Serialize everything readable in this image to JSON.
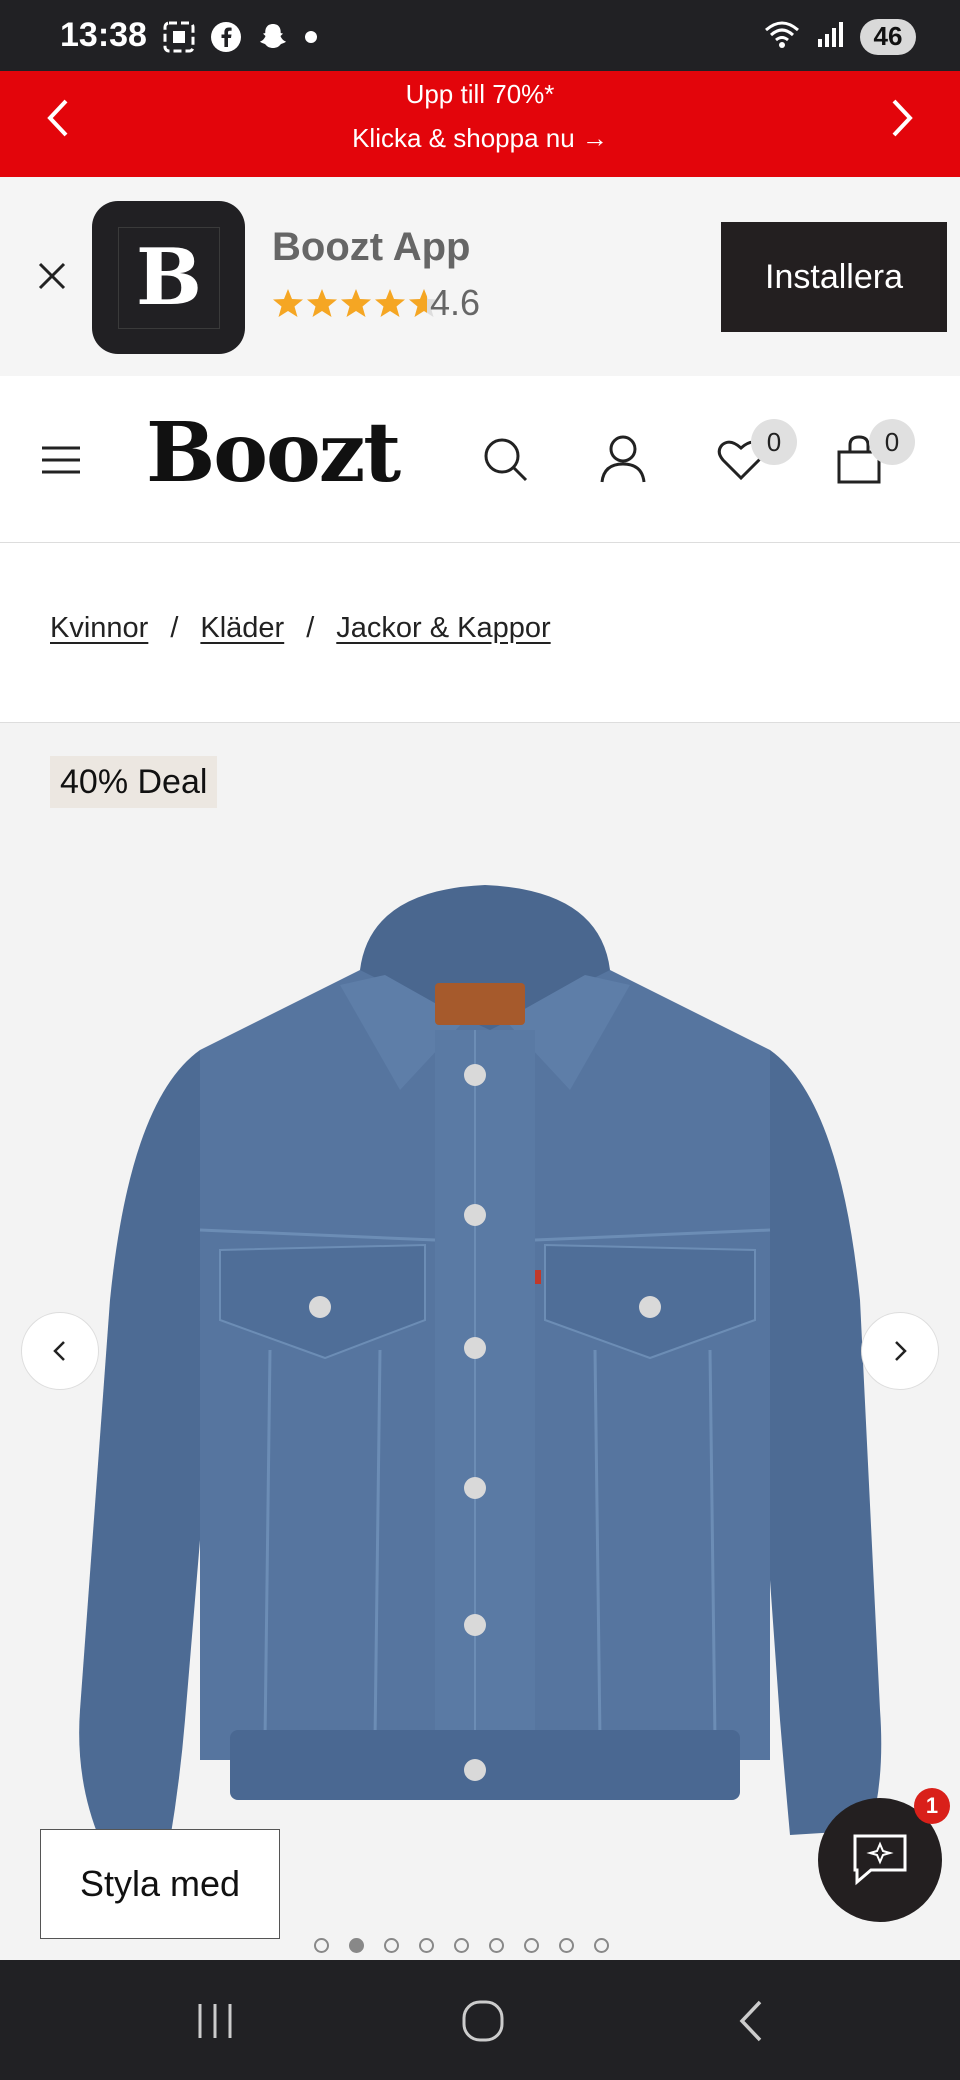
{
  "status_bar": {
    "time": "13:38",
    "battery": "46",
    "icons": [
      "screen-record-icon",
      "facebook-icon",
      "snapchat-icon",
      "dot-icon",
      "wifi-icon",
      "signal-icon"
    ]
  },
  "promo": {
    "line1": "Upp till 70%*",
    "line2": "Klicka & shoppa nu →",
    "color": "#e3050b"
  },
  "app_banner": {
    "app_name": "Boozt App",
    "logo_letter": "B",
    "rating": "4.6",
    "stars": 4.6,
    "install_label": "Installera"
  },
  "header": {
    "logo": "Boozt",
    "wishlist_count": "0",
    "cart_count": "0"
  },
  "breadcrumb": {
    "items": [
      "Kvinnor",
      "Kläder",
      "Jackor & Kappor"
    ],
    "separator": "/"
  },
  "product": {
    "deal_badge": "40% Deal",
    "style_with_label": "Styla med",
    "chat_unread": "1",
    "image_count": 9,
    "active_image": 2
  },
  "colors": {
    "accent_red": "#e3050b",
    "dark": "#231f20",
    "star": "#f5a623",
    "denim": "#4a6a95"
  }
}
